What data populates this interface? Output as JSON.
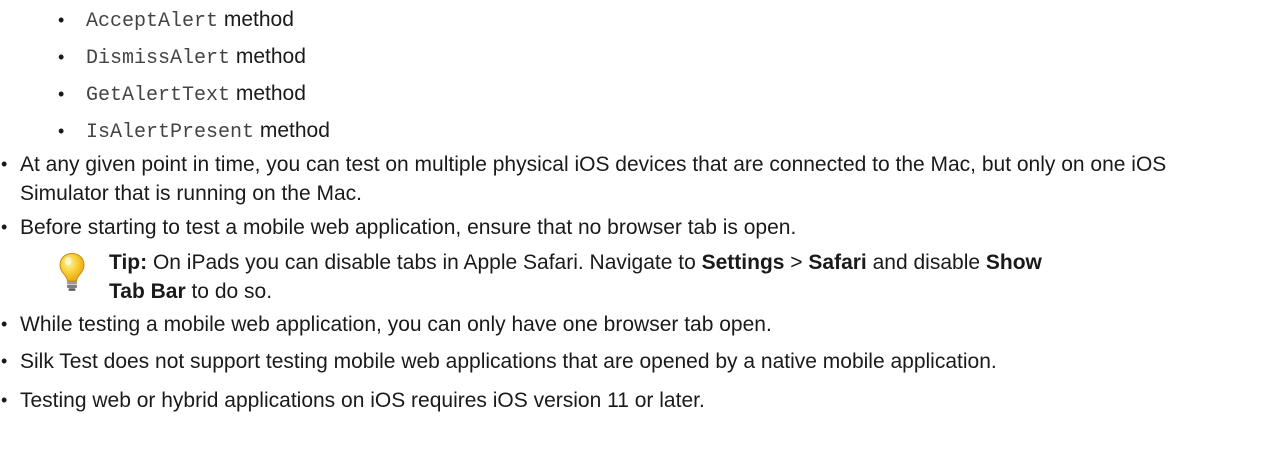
{
  "sub_items": [
    {
      "code": "AcceptAlert",
      "suffix": " method"
    },
    {
      "code": "DismissAlert",
      "suffix": " method"
    },
    {
      "code": "GetAlertText",
      "suffix": " method"
    },
    {
      "code": "IsAlertPresent",
      "suffix": " method"
    }
  ],
  "bullet_glyph": "•",
  "items": {
    "physical": "At any given point in time, you can test on multiple physical iOS devices that are connected to the Mac, but only on one iOS Simulator that is running on the Mac.",
    "tabs": "Before starting to test a mobile web application, ensure that no browser tab is open.",
    "single_tab": "While testing a mobile web application, you can only have one browser tab open.",
    "silk": "Silk Test does not support testing mobile web applications that are opened by a native mobile application.",
    "ios_version": "Testing web or hybrid applications on iOS requires iOS version 11 or later."
  },
  "tip": {
    "label": "Tip:",
    "text_1": " On iPads you can disable tabs in Apple Safari. Navigate to ",
    "settings": "Settings",
    "sep": " > ",
    "safari": "Safari",
    "text_2": " and disable ",
    "show_tab_bar": "Show Tab Bar",
    "text_3": " to do so."
  },
  "colors": {
    "text": "#1a1a1a",
    "code": "#444444",
    "bulb": "#f7c21a"
  }
}
